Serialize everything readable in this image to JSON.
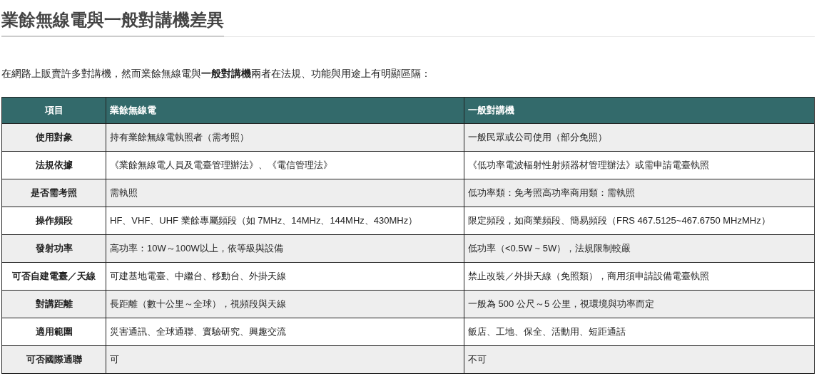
{
  "title": "業餘無線電與一般對講機差異",
  "intro": "在網路上販賣許多對講機，然而業餘無線電與**一般對講機**兩者在法規、功能與用途上有明顯區隔：",
  "table": {
    "columns": [
      "項目",
      "業餘無線電",
      "一般對講機"
    ],
    "rows": [
      [
        "使用對象",
        "持有業餘無線電執照者（需考照）",
        "一般民眾或公司使用（部分免照）"
      ],
      [
        "法規依據",
        "《業餘無線電人員及電臺管理辦法》、《電信管理法》",
        "《低功率電波輻射性射頻器材管理辦法》或需申請電臺執照"
      ],
      [
        "是否需考照",
        "需執照",
        "低功率類：免考照高功率商用類：需執照"
      ],
      [
        "操作頻段",
        "HF、VHF、UHF 業餘專屬頻段（如 7MHz、14MHz、144MHz、430MHz）",
        "限定頻段，如商業頻段、簡易頻段（FRS 467.5125~467.6750 MHzMHz）"
      ],
      [
        "發射功率",
        "高功率：10W～100W以上，依等級與設備",
        "低功率（<0.5W ~ 5W），法規限制較嚴"
      ],
      [
        "可否自建電臺／天線",
        "可建基地電臺、中繼台、移動台、外掛天線",
        "禁止改裝／外掛天線（免照類），商用須申請設備電臺執照"
      ],
      [
        "對講距離",
        "長距離（數十公里～全球），視頻段與天線",
        "一般為 500 公尺～5 公里，視環境與功率而定"
      ],
      [
        "適用範圍",
        "災害通訊、全球通聯、實驗研究、興趣交流",
        "飯店、工地、保全、活動用、短距通話"
      ],
      [
        "可否國際通聯",
        "可",
        "不可"
      ]
    ]
  }
}
